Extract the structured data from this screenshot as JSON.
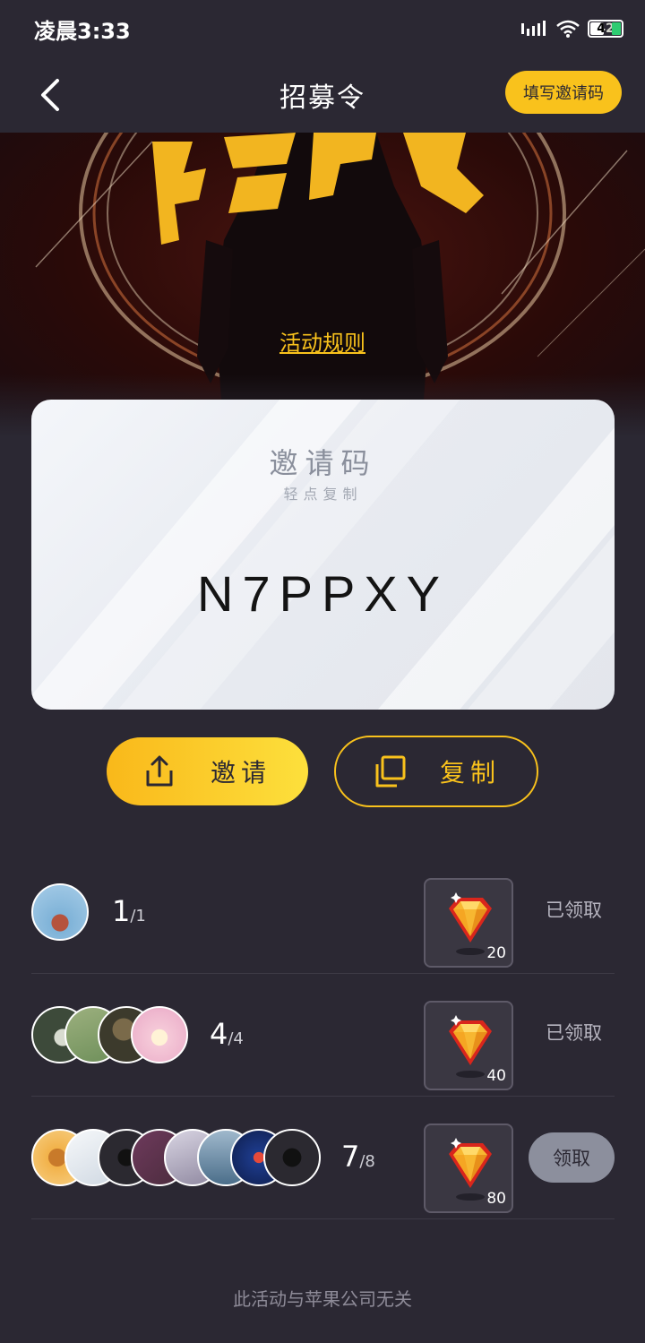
{
  "status_bar": {
    "time": "凌晨3:33",
    "battery": "42"
  },
  "nav": {
    "title": "招募令",
    "fill_invite_code": "填写邀请码"
  },
  "hero": {
    "rules_link": "活动规则"
  },
  "card": {
    "label": "邀请码",
    "sub": "轻点复制",
    "code": "N7PPXY"
  },
  "actions": {
    "invite": "邀请",
    "copy": "复制"
  },
  "tiers": [
    {
      "count": "1",
      "total": "/1",
      "reward": "20",
      "status": "已领取",
      "avatar_colors": [
        "#7fb3d8"
      ]
    },
    {
      "count": "4",
      "total": "/4",
      "reward": "40",
      "status": "已领取",
      "avatar_colors": [
        "#3d4a3a",
        "#6e8f5a",
        "#3c3a2c",
        "#f5c9d8"
      ]
    },
    {
      "count": "7",
      "total": "/8",
      "reward": "80",
      "claim": "领取",
      "avatar_colors": [
        "#f2b24a",
        "#dfe6ee",
        "#2b2930",
        "#4a2b3c",
        "#b9b3c6",
        "#4b6e8a",
        "#1d3a8a",
        "#2b2930"
      ]
    }
  ],
  "footer": {
    "note": "此活动与苹果公司无关"
  },
  "colors": {
    "accent": "#f9c21c",
    "background": "#2b2833"
  }
}
